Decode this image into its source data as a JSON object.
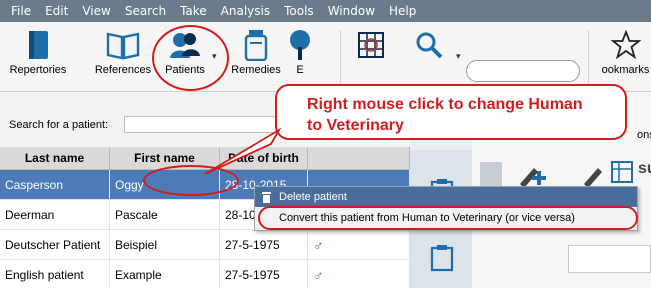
{
  "menu": [
    "File",
    "Edit",
    "View",
    "Search",
    "Take",
    "Analysis",
    "Tools",
    "Window",
    "Help"
  ],
  "toolbar": {
    "repertories": "Repertories",
    "references": "References",
    "patients": "Patients",
    "remedies": "Remedies",
    "partial_e": "E",
    "bookmarks_partial": "ookmarks"
  },
  "patients": {
    "search_label": "Search for a patient:",
    "columns": [
      "Last name",
      "First name",
      "Date of birth"
    ],
    "rows": [
      {
        "last": "Casperson",
        "first": "Oggy",
        "dob": "28-10-2015",
        "gender": ""
      },
      {
        "last": "Deerman",
        "first": "Pascale",
        "dob": "28-10-",
        "gender": ""
      },
      {
        "last": "Deutscher Patient",
        "first": "Beispiel",
        "dob": "27-5-1975",
        "gender": "♂"
      },
      {
        "last": "English patient",
        "first": "Example",
        "dob": "27-5-1975",
        "gender": "♂"
      }
    ]
  },
  "callout": "Right mouse click to change Human to Veterinary",
  "context_menu": {
    "delete": "Delete patient",
    "convert": "Convert this patient from Human to Veterinary (or vice versa)"
  },
  "right_panel": {
    "consult": "onsult",
    "su": "su"
  },
  "colors": {
    "accent_red": "#d01e1e",
    "selection": "#4d7ab8",
    "menubar": "#6b7b8c"
  }
}
